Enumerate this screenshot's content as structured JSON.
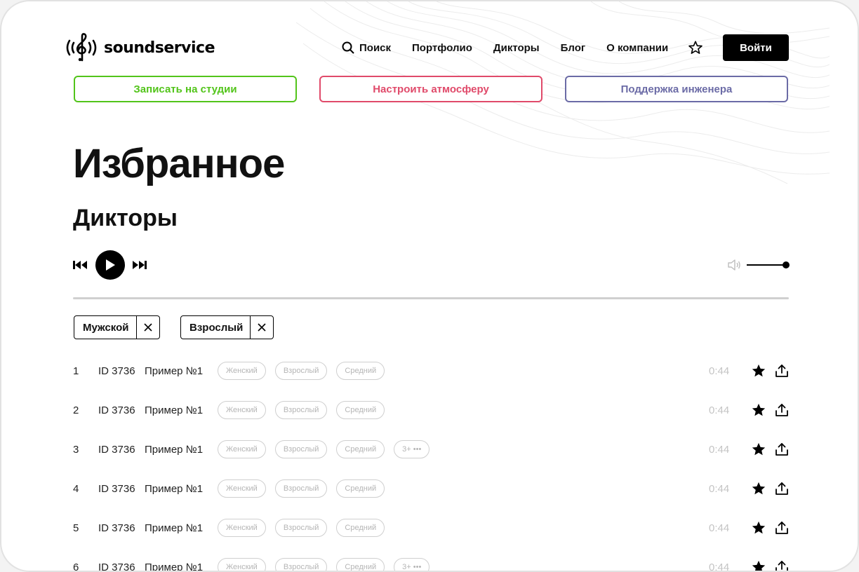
{
  "brand": {
    "name": "soundservice"
  },
  "nav": {
    "items": [
      {
        "label": "Поиск",
        "icon": "search-icon"
      },
      {
        "label": "Портфолио"
      },
      {
        "label": "Дикторы"
      },
      {
        "label": "Блог"
      },
      {
        "label": "О компании"
      }
    ],
    "favorites_icon": "star-outline-icon",
    "login_label": "Войти"
  },
  "actions": [
    {
      "label": "Записать на студии",
      "color": "#52c41a"
    },
    {
      "label": "Настроить атмосферу",
      "color": "#e04a6a"
    },
    {
      "label": "Поддержка инженера",
      "color": "#6b6ba6"
    }
  ],
  "page": {
    "title": "Избранное",
    "section": "Дикторы"
  },
  "player": {
    "prev_icon": "skip-back-icon",
    "play_icon": "play-icon",
    "next_icon": "skip-forward-icon",
    "volume_icon": "speaker-icon",
    "volume": 1.0,
    "progress": 0
  },
  "filters": [
    {
      "label": "Мужской"
    },
    {
      "label": "Взрослый"
    }
  ],
  "tracks": [
    {
      "num": "1",
      "id": "ID 3736",
      "name": "Пример №1",
      "tags": [
        "Женский",
        "Взрослый",
        "Средний"
      ],
      "more": "",
      "duration": "0:44"
    },
    {
      "num": "2",
      "id": "ID 3736",
      "name": "Пример №1",
      "tags": [
        "Женский",
        "Взрослый",
        "Средний"
      ],
      "more": "",
      "duration": "0:44"
    },
    {
      "num": "3",
      "id": "ID 3736",
      "name": "Пример №1",
      "tags": [
        "Женский",
        "Взрослый",
        "Средний"
      ],
      "more": "3+ •••",
      "duration": "0:44"
    },
    {
      "num": "4",
      "id": "ID 3736",
      "name": "Пример №1",
      "tags": [
        "Женский",
        "Взрослый",
        "Средний"
      ],
      "more": "",
      "duration": "0:44"
    },
    {
      "num": "5",
      "id": "ID 3736",
      "name": "Пример №1",
      "tags": [
        "Женский",
        "Взрослый",
        "Средний"
      ],
      "more": "",
      "duration": "0:44"
    },
    {
      "num": "6",
      "id": "ID 3736",
      "name": "Пример №1",
      "tags": [
        "Женский",
        "Взрослый",
        "Средний"
      ],
      "more": "3+ •••",
      "duration": "0:44"
    }
  ]
}
